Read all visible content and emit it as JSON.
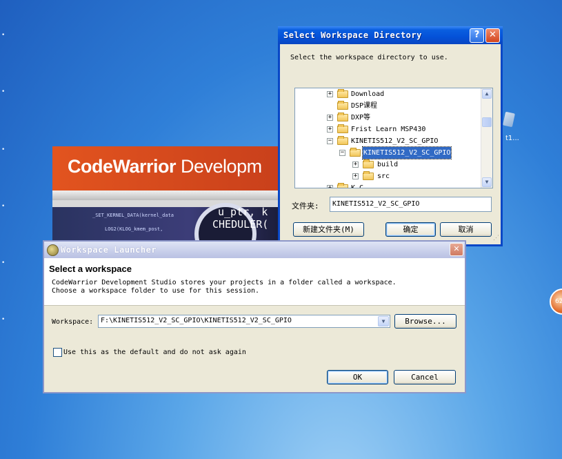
{
  "desktop": {
    "icon_label": "t1...",
    "orb_text": "62"
  },
  "splash": {
    "title_bold": "CodeWarrior",
    "title_light": "Developm",
    "code_line1": "_SET_KERNEL_DATA(kernel_data",
    "code_line2": "LOG2(KLOG_kmem_post,",
    "code_big1": "u_ptr, k",
    "code_big2": "CHEDULER("
  },
  "dir_dialog": {
    "title": "Select Workspace Directory",
    "help_label": "?",
    "close_label": "✕",
    "instruction": "Select the workspace directory to use.",
    "tree": [
      {
        "label": "Download",
        "toggle": "+",
        "level": 0
      },
      {
        "label": "DSP课程",
        "toggle": "",
        "level": 0
      },
      {
        "label": "DXP等",
        "toggle": "+",
        "level": 0
      },
      {
        "label": "Frist Learn MSP430",
        "toggle": "+",
        "level": 0
      },
      {
        "label": "KINETIS512_V2_SC_GPIO",
        "toggle": "−",
        "level": 0
      },
      {
        "label": "KINETIS512_V2_SC_GPIO",
        "toggle": "−",
        "level": 1,
        "selected": true
      },
      {
        "label": "build",
        "toggle": "+",
        "level": 2
      },
      {
        "label": "src",
        "toggle": "+",
        "level": 2
      },
      {
        "label": "K C",
        "toggle": "+",
        "level": 0
      }
    ],
    "folder_label": "文件夹:",
    "folder_value": "KINETIS512_V2_SC_GPIO",
    "new_folder_label": "新建文件夹(M)",
    "ok_label": "确定",
    "cancel_label": "取消"
  },
  "launcher": {
    "title": "Workspace Launcher",
    "close_label": "✕",
    "heading": "Select a workspace",
    "desc_line1": "CodeWarrior Development Studio stores your projects in a folder called a workspace.",
    "desc_line2": "Choose a workspace folder to use for this session.",
    "workspace_label": "Workspace:",
    "workspace_value": "F:\\KINETIS512_V2_SC_GPIO\\KINETIS512_V2_SC_GPIO",
    "browse_label": "Browse...",
    "default_checkbox_label": "Use this as the default and do not ask again",
    "default_checked": false,
    "ok_label": "OK",
    "cancel_label": "Cancel"
  }
}
